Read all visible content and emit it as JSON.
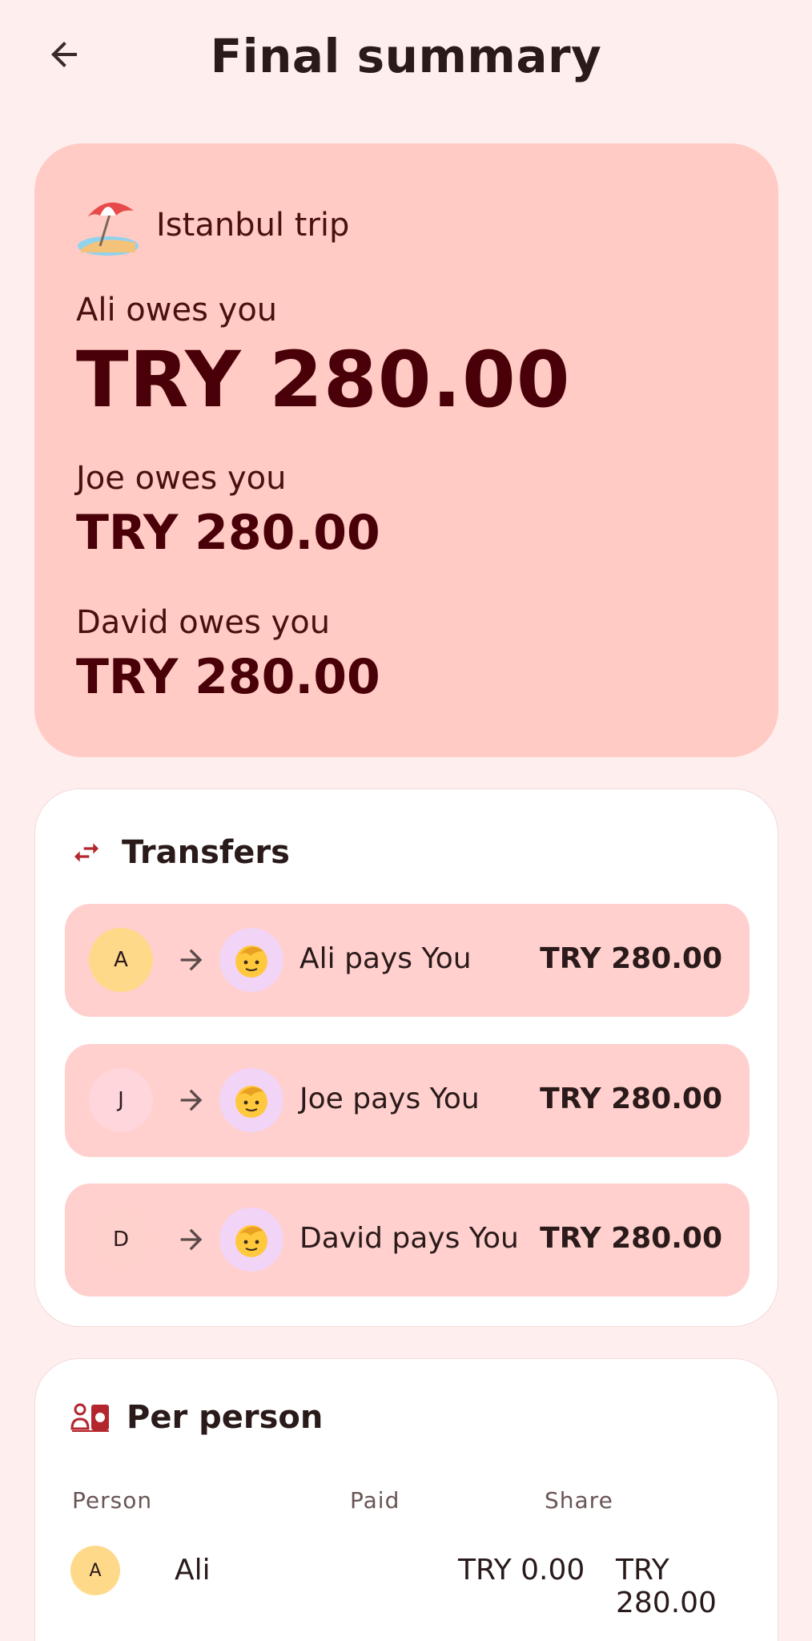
{
  "header": {
    "title": "Final summary"
  },
  "trip": {
    "name": "Istanbul trip",
    "icon": "beach-umbrella-icon",
    "debts": [
      {
        "label": "Ali owes you",
        "amount": "TRY 280.00"
      },
      {
        "label": "Joe owes you",
        "amount": "TRY 280.00"
      },
      {
        "label": "David owes you",
        "amount": "TRY 280.00"
      }
    ]
  },
  "transfers": {
    "title": "Transfers",
    "items": [
      {
        "initial": "A",
        "label": "Ali pays You",
        "amount": "TRY 280.00",
        "color": "#ffd98a"
      },
      {
        "initial": "J",
        "label": "Joe pays You",
        "amount": "TRY 280.00",
        "color": "#ffd6dc"
      },
      {
        "initial": "D",
        "label": "David pays You",
        "amount": "TRY 280.00",
        "color": "#ffd1cc"
      }
    ]
  },
  "per_person": {
    "title": "Per person",
    "columns": {
      "person": "Person",
      "paid": "Paid",
      "share": "Share"
    },
    "rows": [
      {
        "initial": "A",
        "name": "Ali",
        "paid": "TRY 0.00",
        "share": "TRY 280.00"
      }
    ]
  },
  "colors": {
    "accent": "#b3262d",
    "hero_bg": "#ffcbc4",
    "page_bg": "#ffeeee"
  }
}
